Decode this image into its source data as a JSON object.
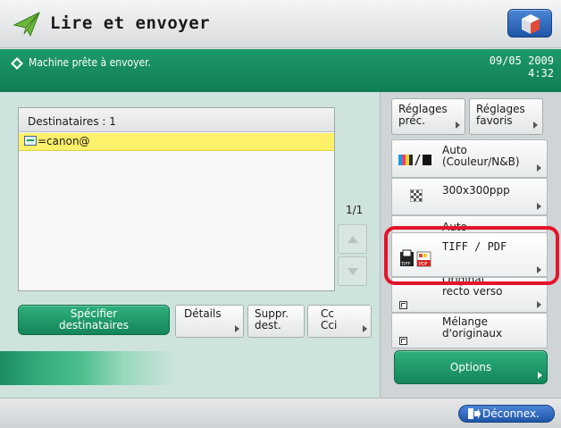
{
  "header": {
    "title": "Lire et envoyer",
    "app_icon": "paper-plane-icon",
    "home_icon": "home-cube-icon"
  },
  "status": {
    "message": "Machine prête à envoyer.",
    "date": "09/05 2009",
    "time": "4:32"
  },
  "destinations": {
    "header": "Destinataires : 1",
    "rows": [
      "=canon@"
    ],
    "page": "1/1"
  },
  "buttons": {
    "specify_line1": "Spécifier",
    "specify_line2": "destinataires",
    "details": "Détails",
    "suppr_line1": "Suppr.",
    "suppr_line2": "dest.",
    "cc_line1": "Cc",
    "cc_line2": "Cci"
  },
  "right": {
    "reglages_prec_line1": "Réglages",
    "reglages_prec_line2": "préc.",
    "reglages_fav_line1": "Réglages",
    "reglages_fav_line2": "favoris",
    "color_line1": "Auto",
    "color_line2": "(Couleur/N&B)",
    "resolution": "300x300ppp",
    "auto": "Auto",
    "format": "TIFF / PDF",
    "recto_line1": "Original",
    "recto_line2": "recto verso",
    "melange_line1": "Mélange",
    "melange_line2": "d'originaux",
    "options": "Options"
  },
  "footer": {
    "logout": "Déconnex."
  },
  "colors": {
    "accent_green": "#14855a",
    "status_green": "#0f7c53",
    "highlight_red": "#e3142b",
    "selection_yellow": "#fff06a"
  }
}
